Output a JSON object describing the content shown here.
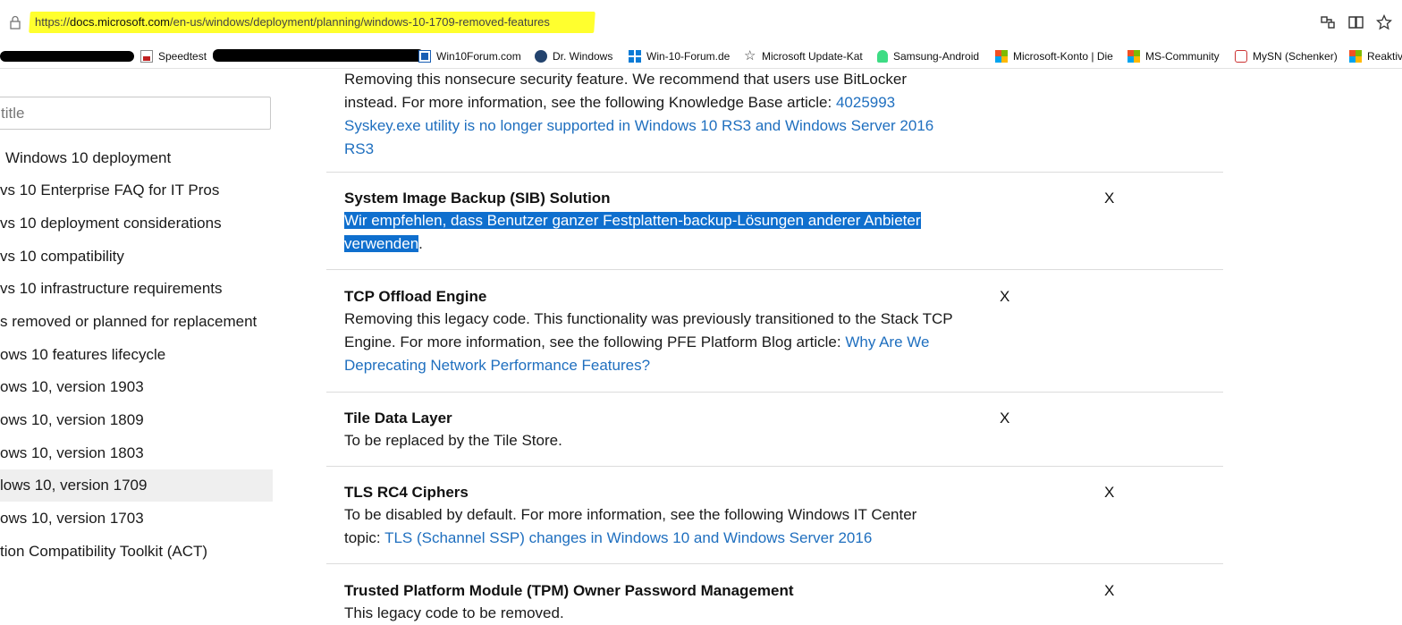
{
  "address_bar": {
    "url_prefix": "https://",
    "url_host": "docs.microsoft.com",
    "url_path": "/en-us/windows/deployment/planning/windows-10-1709-removed-features",
    "toolbar_icons": [
      "sharing-icon",
      "reading-view-icon",
      "favorite-star-icon"
    ]
  },
  "favorites": [
    {
      "label": "Speedtest",
      "icon": "speedtest-icon"
    },
    {
      "label": "Win10Forum.com",
      "icon": "win10forum-icon"
    },
    {
      "label": "Dr. Windows",
      "icon": "dr-windows-icon"
    },
    {
      "label": "Win-10-Forum.de",
      "icon": "windows-logo-icon"
    },
    {
      "label": "Microsoft Update-Kat",
      "icon": "star-icon"
    },
    {
      "label": "Samsung-Android",
      "icon": "android-icon"
    },
    {
      "label": "Microsoft-Konto | Die",
      "icon": "microsoft-logo-icon"
    },
    {
      "label": "MS-Community",
      "icon": "microsoft-logo-icon"
    },
    {
      "label": "MySN (Schenker)",
      "icon": "mysn-icon"
    },
    {
      "label": "Reaktiv",
      "icon": "microsoft-logo-icon"
    }
  ],
  "sidebar": {
    "filter_placeholder": "title",
    "items": [
      {
        "label": "Windows 10 deployment"
      },
      {
        "label": "vs 10 Enterprise FAQ for IT Pros"
      },
      {
        "label": "vs 10 deployment considerations"
      },
      {
        "label": "vs 10 compatibility"
      },
      {
        "label": "vs 10 infrastructure requirements"
      },
      {
        "label": "s removed or planned for replacement"
      },
      {
        "label": "ows 10 features lifecycle"
      },
      {
        "label": "ows 10, version 1903"
      },
      {
        "label": "ows 10, version 1809"
      },
      {
        "label": "ows 10, version 1803"
      },
      {
        "label": "lows 10, version 1709",
        "active": true
      },
      {
        "label": "ows 10, version 1703"
      },
      {
        "label": "tion Compatibility Toolkit (ACT)"
      }
    ]
  },
  "content": {
    "syskey": {
      "line1": "Removing this nonsecure security feature. We recommend that users use BitLocker",
      "line2_text": "instead. For more information, see the following Knowledge Base article: ",
      "line2_link": "4025993",
      "line3_link": "Syskey.exe utility is no longer supported in Windows 10 RS3 and Windows Server 2016",
      "line4_link": "RS3"
    },
    "sib": {
      "title": "System Image Backup (SIB) Solution",
      "desc_line1": "Wir empfehlen, dass Benutzer ganzer Festplatten-backup-Lösungen anderer Anbieter",
      "desc_line2": "verwenden",
      "desc_end": ".",
      "mark": "X"
    },
    "tcp": {
      "title": "TCP Offload Engine",
      "line1": "Removing this legacy code. This functionality was previously transitioned to the Stack TCP",
      "line2_text": "Engine. For more information, see the following PFE Platform Blog article: ",
      "line2_link": "Why Are We",
      "line3_link": "Deprecating Network Performance Features?",
      "mark": "X"
    },
    "tile": {
      "title": "Tile Data Layer",
      "desc": "To be replaced by the Tile Store.",
      "mark": "X"
    },
    "tls": {
      "title": "TLS RC4 Ciphers",
      "line1": "To be disabled by default. For more information, see the following Windows IT Center",
      "line2_text": "topic: ",
      "line2_link": "TLS (Schannel SSP) changes in Windows 10 and Windows Server 2016",
      "mark": "X"
    },
    "tpm": {
      "title": "Trusted Platform Module (TPM) Owner Password Management",
      "desc": "This legacy code to be removed.",
      "mark": "X"
    }
  },
  "colors": {
    "url_highlight": "#ffff2e",
    "link": "#1f6fbf",
    "selection": "#0f6fce",
    "active_toc": "#efefef"
  }
}
